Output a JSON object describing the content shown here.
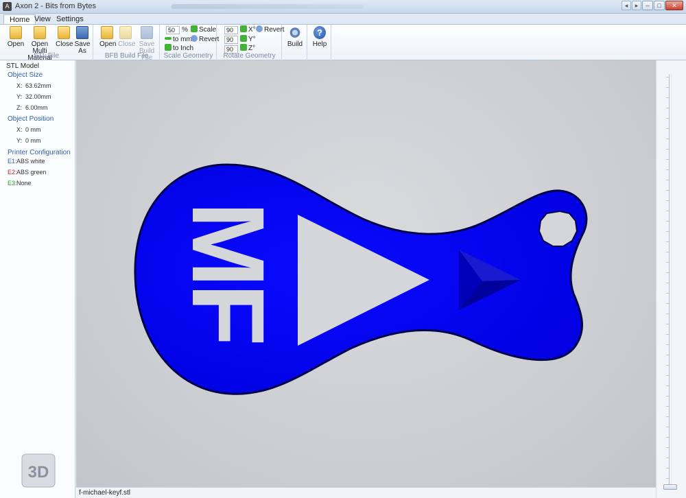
{
  "window": {
    "title": "Axon 2 - Bits from Bytes"
  },
  "tabs": [
    "Home",
    "View",
    "Settings"
  ],
  "ribbon": {
    "stl_file": {
      "label": "STL File",
      "open": "Open",
      "open_multi_1": "Open Multi",
      "open_multi_2": "Material",
      "close": "Close",
      "save_as_1": "Save",
      "save_as_2": "As"
    },
    "bfb_file": {
      "label": "BFB Build File",
      "open": "Open",
      "close": "Close",
      "save_1": "Save",
      "save_2": "Build File"
    },
    "scale": {
      "label": "Scale Geometry",
      "percent_value": "50",
      "percent_sign": "%",
      "scale": "Scale",
      "to_mm": "to mm",
      "revert": "Revert",
      "to_inch": "to Inch"
    },
    "rotate": {
      "label": "Rotate Geometry",
      "x_value": "90",
      "y_value": "90",
      "z_value": "90",
      "x": "X°",
      "y": "Y°",
      "z": "Z°",
      "revert": "Revert"
    },
    "build": "Build",
    "help": "Help"
  },
  "panel": {
    "title": "STL Model",
    "object_size": {
      "header": "Object Size",
      "x_label": "X:",
      "x": "63.62mm",
      "y_label": "Y:",
      "y": "32.00mm",
      "z_label": "Z:",
      "z": "6.00mm"
    },
    "object_position": {
      "header": "Object Position",
      "x_label": "X:",
      "x": "0 mm",
      "y_label": "Y:",
      "y": "0 mm"
    },
    "printer": {
      "header": "Printer Configuration",
      "e1_label": "E1:",
      "e1": "ABS white",
      "e1_color": "#2b5fb5",
      "e2_label": "E2:",
      "e2": "ABS green",
      "e2_color": "#d02020",
      "e3_label": "E3:",
      "e3": "None",
      "e3_color": "#20a020"
    },
    "logo_text": "3D"
  },
  "model": {
    "color": "#0000ff",
    "outline": "#00004a",
    "text": "MF"
  },
  "status": {
    "filename": "f-michael-keyf.stl"
  }
}
